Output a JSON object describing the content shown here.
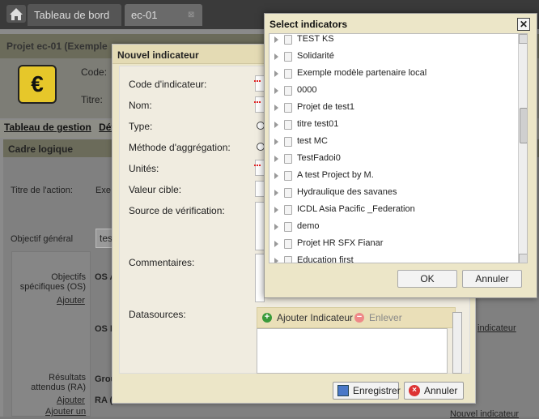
{
  "topbar": {
    "tabs": [
      {
        "label": "Tableau de bord"
      },
      {
        "label": "ec-01"
      }
    ],
    "close_glyph": "⊠"
  },
  "project": {
    "title": "Projet ec-01 (Exemple",
    "code_label": "Code:",
    "titre_label": "Titre:",
    "icon_glyph": "€"
  },
  "nav": {
    "links": [
      "Tableau de gestion",
      "Dét"
    ]
  },
  "cadre": {
    "heading": "Cadre logique",
    "titre_action_label": "Titre de l'action:",
    "titre_action_value": "Exe",
    "objectif_general_label": "Objectif général",
    "objectif_general_value": "tes",
    "os_label": "Objectifs spécifiques (OS)",
    "os_add": "Ajouter",
    "os_a": "OS A",
    "os_b": "OS B",
    "os_indicator_link": "indicateur",
    "ra_label": "Résultats attendus (RA)",
    "ra_add": "Ajouter",
    "ra_add_un": "Ajouter un",
    "group_label": "Grou",
    "ra_item": "RA (",
    "nouvel_indicateur_link": "Nouvel indicateur"
  },
  "dialog": {
    "title": "Nouvel indicateur",
    "fields": [
      {
        "label": "Code d'indicateur:"
      },
      {
        "label": "Nom:"
      },
      {
        "label": "Type:"
      },
      {
        "label": "Méthode d'aggrégation:"
      },
      {
        "label": "Unités:"
      },
      {
        "label": "Valeur cible:"
      },
      {
        "label": "Source de vérification:"
      },
      {
        "label": "Commentaires:"
      },
      {
        "label": "Datasources:"
      }
    ],
    "add_indicator": "Ajouter Indicateur",
    "remove": "Enlever",
    "save": "Enregistrer",
    "cancel": "Annuler"
  },
  "select": {
    "title": "Select indicators",
    "items": [
      "TEST KS",
      "Solidarité",
      "Exemple modèle partenaire local",
      "0000",
      "Projet de test1",
      "titre test01",
      "test MC",
      "TestFadoi0",
      "A test Project by M.",
      "Hydraulique des savanes",
      "ICDL Asia Pacific _Federation",
      "demo",
      "Projet HR SFX Fianar",
      "Education first"
    ],
    "ok": "OK",
    "cancel": "Annuler"
  }
}
